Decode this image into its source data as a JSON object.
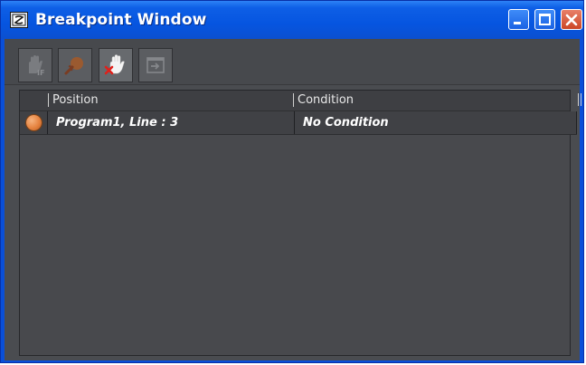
{
  "window": {
    "title": "Breakpoint Window",
    "title_color": "#ffffff",
    "titlebar_color": "#0655e0",
    "controls": [
      "minimize-icon",
      "maximize-icon",
      "close-icon"
    ]
  },
  "toolbar": {
    "buttons": [
      {
        "name": "toggle-conditional-breakpoint-icon",
        "enabled": false
      },
      {
        "name": "step-out-icon",
        "enabled": false
      },
      {
        "name": "remove-breakpoint-icon",
        "enabled": true
      },
      {
        "name": "go-to-position-icon",
        "enabled": false
      }
    ]
  },
  "grid": {
    "columns": [
      "Position",
      "Condition"
    ],
    "rows": [
      {
        "position": "Program1, Line : 3",
        "condition": "No Condition",
        "marker_color": "#e5823f"
      }
    ]
  },
  "colors": {
    "client_bg": "#4a4c50",
    "grid_bg": "#48494d",
    "row_bg": "#404145"
  }
}
